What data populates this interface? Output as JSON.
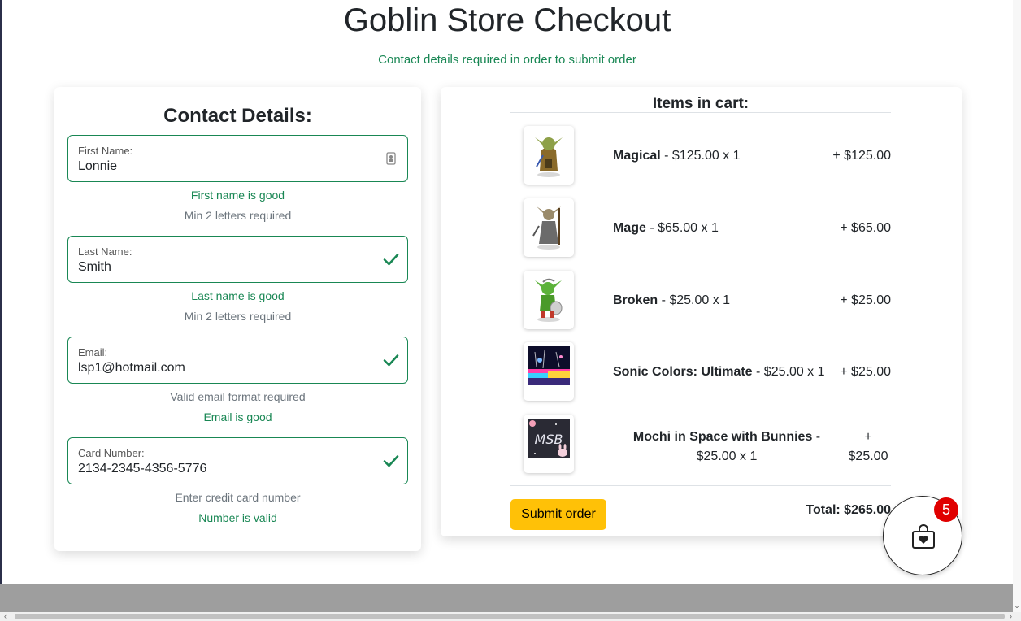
{
  "page": {
    "title": "Goblin Store Checkout",
    "subtitle": "Contact details required in order to submit order"
  },
  "contact": {
    "heading": "Contact Details:",
    "first_name": {
      "label": "First Name:",
      "value": "Lonnie",
      "status": "First name is good",
      "hint": "Min 2 letters required"
    },
    "last_name": {
      "label": "Last Name:",
      "value": "Smith",
      "status": "Last name is good",
      "hint": "Min 2 letters required"
    },
    "email": {
      "label": "Email:",
      "value": "lsp1@hotmail.com",
      "hint": "Valid email format required",
      "status": "Email is good"
    },
    "card": {
      "label": "Card Number:",
      "value": "2134-2345-4356-5776",
      "hint": "Enter credit card number",
      "status": "Number is valid"
    }
  },
  "cart": {
    "heading": "Items in cart:",
    "items": [
      {
        "name": "Magical",
        "detail": " - $125.00 x 1",
        "total": "+ $125.00"
      },
      {
        "name": "Mage",
        "detail": " - $65.00 x 1",
        "total": "+ $65.00"
      },
      {
        "name": "Broken",
        "detail": " - $25.00 x 1",
        "total": "+ $25.00"
      },
      {
        "name": "Sonic Colors: Ultimate",
        "detail": " - $25.00 x 1",
        "total": "+ $25.00"
      },
      {
        "name": "Mochi in Space with Bunnies",
        "detail": " - $25.00 x 1",
        "total": "+ $25.00"
      }
    ],
    "submit_label": "Submit order",
    "total": "Total: $265.00",
    "badge_count": "5"
  },
  "colors": {
    "success": "#198754",
    "accent": "#ffc107",
    "badge": "#e00000"
  }
}
